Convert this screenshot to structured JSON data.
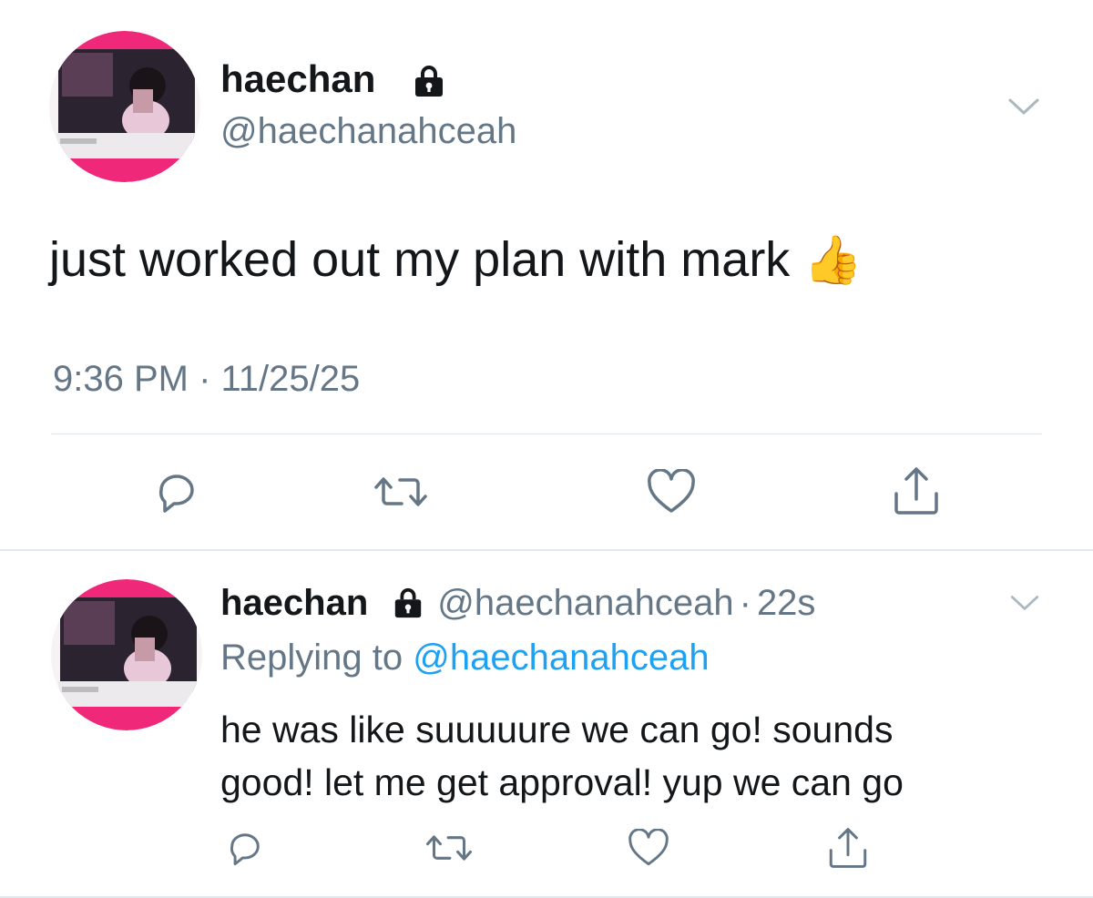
{
  "main_tweet": {
    "display_name": "haechan",
    "handle": "@haechanahceah",
    "text": "just worked out my plan with mark",
    "emoji": "👍",
    "timestamp": "9:36 PM · 11/25/25",
    "icons": {
      "protected": "lock-icon",
      "menu": "chevron-down-icon",
      "reply": "reply-icon",
      "retweet": "retweet-icon",
      "like": "heart-icon",
      "share": "share-icon"
    }
  },
  "reply_tweet": {
    "display_name": "haechan",
    "handle": "@haechanahceah",
    "dot": "·",
    "age": "22s",
    "replying_prefix": "Replying to",
    "replying_to": "@haechanahceah",
    "text_line_1": "he was like suuuuure we can go! sounds",
    "text_line_2": "good! let me get approval! yup we can go"
  },
  "colors": {
    "text": "#14171a",
    "secondary": "#657786",
    "link": "#1da1f2",
    "divider": "#e1e8ed",
    "avatar_accent": "#f0287a"
  }
}
